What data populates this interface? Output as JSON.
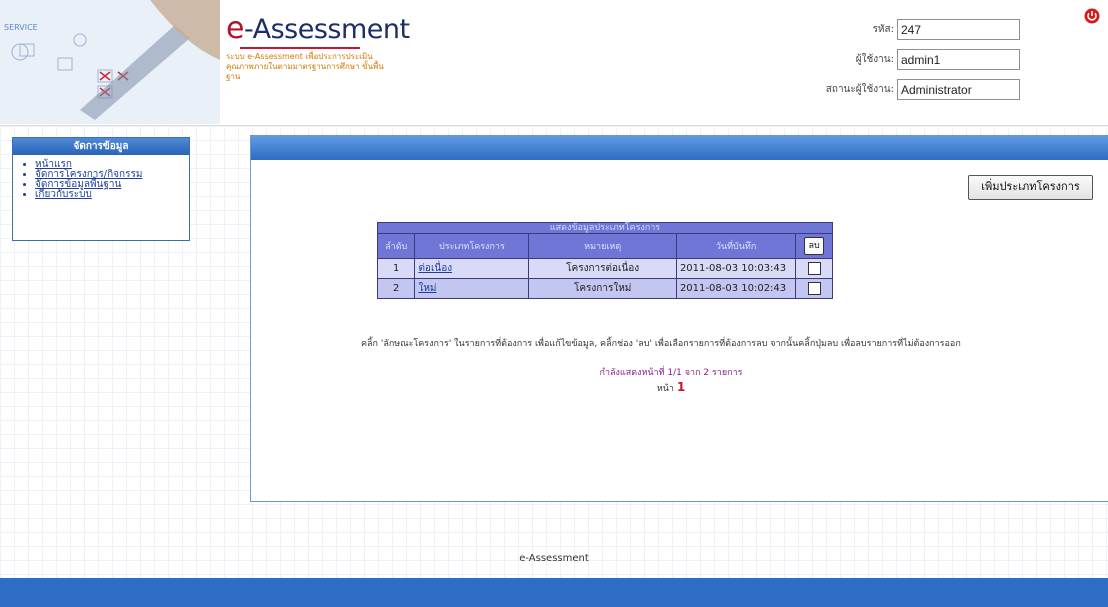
{
  "header": {
    "title": "e-Assessment",
    "title_prefix": "e",
    "title_rest": "-Assessment",
    "subtitle": "ระบบ e-Assessment เพื่อประการประเมิน คุณภาพภายในตามมาตรฐานการศึกษา ขั้นพื้นฐาน",
    "fields": [
      {
        "label": "รหัส:",
        "value": "247"
      },
      {
        "label": "ผู้ใช้งาน:",
        "value": "admin1"
      },
      {
        "label": "สถานะผู้ใช้งาน:",
        "value": "Administrator"
      }
    ],
    "power_icon": "power-icon"
  },
  "sidebar": {
    "title": "จัดการข้อมูล",
    "items": [
      {
        "label": "หน้าแรก"
      },
      {
        "label": "จัดการโครงการ/กิจกรรม"
      },
      {
        "label": "จัดการข้อมูลพื้นฐาน"
      },
      {
        "label": "เกี่ยวกับระบบ"
      }
    ]
  },
  "main": {
    "add_button": "เพิ่มประเภทโครงการ",
    "table": {
      "caption": "แสดงข้อมูลประเภทโครงการ",
      "columns": [
        "ลำดับ",
        "ประเภทโครงการ",
        "หมายเหตุ",
        "วันที่บันทึก"
      ],
      "delete_label": "ลบ",
      "rows": [
        {
          "no": "1",
          "type": "ต่อเนื่อง",
          "note": "โครงการต่อเนื่อง",
          "date": "2011-08-03 10:03:43"
        },
        {
          "no": "2",
          "type": "ใหม่",
          "note": "โครงการใหม่",
          "date": "2011-08-03 10:02:43"
        }
      ]
    },
    "help_text": "คลิ้ก 'ลักษณะโครงการ' ในรายการที่ต้องการ เพื่อแก้ไขข้อมูล, คลิ้กช่อง 'ลบ' เพื่อเลือกรายการที่ต้องการลบ จากนั้นคลิ้กปุ่มลบ เพื่อลบรายการที่ไม่ต้องการออก",
    "page_info": "กำลังแสดงหน้าที่ 1/1 จาก 2 รายการ",
    "page_label": "หน้า",
    "page_current": "1"
  },
  "footer": {
    "text": "e-Assessment"
  },
  "colors": {
    "accent": "#2e6dc6",
    "table_header": "#6f76d6",
    "brand_red": "#b3132c"
  }
}
